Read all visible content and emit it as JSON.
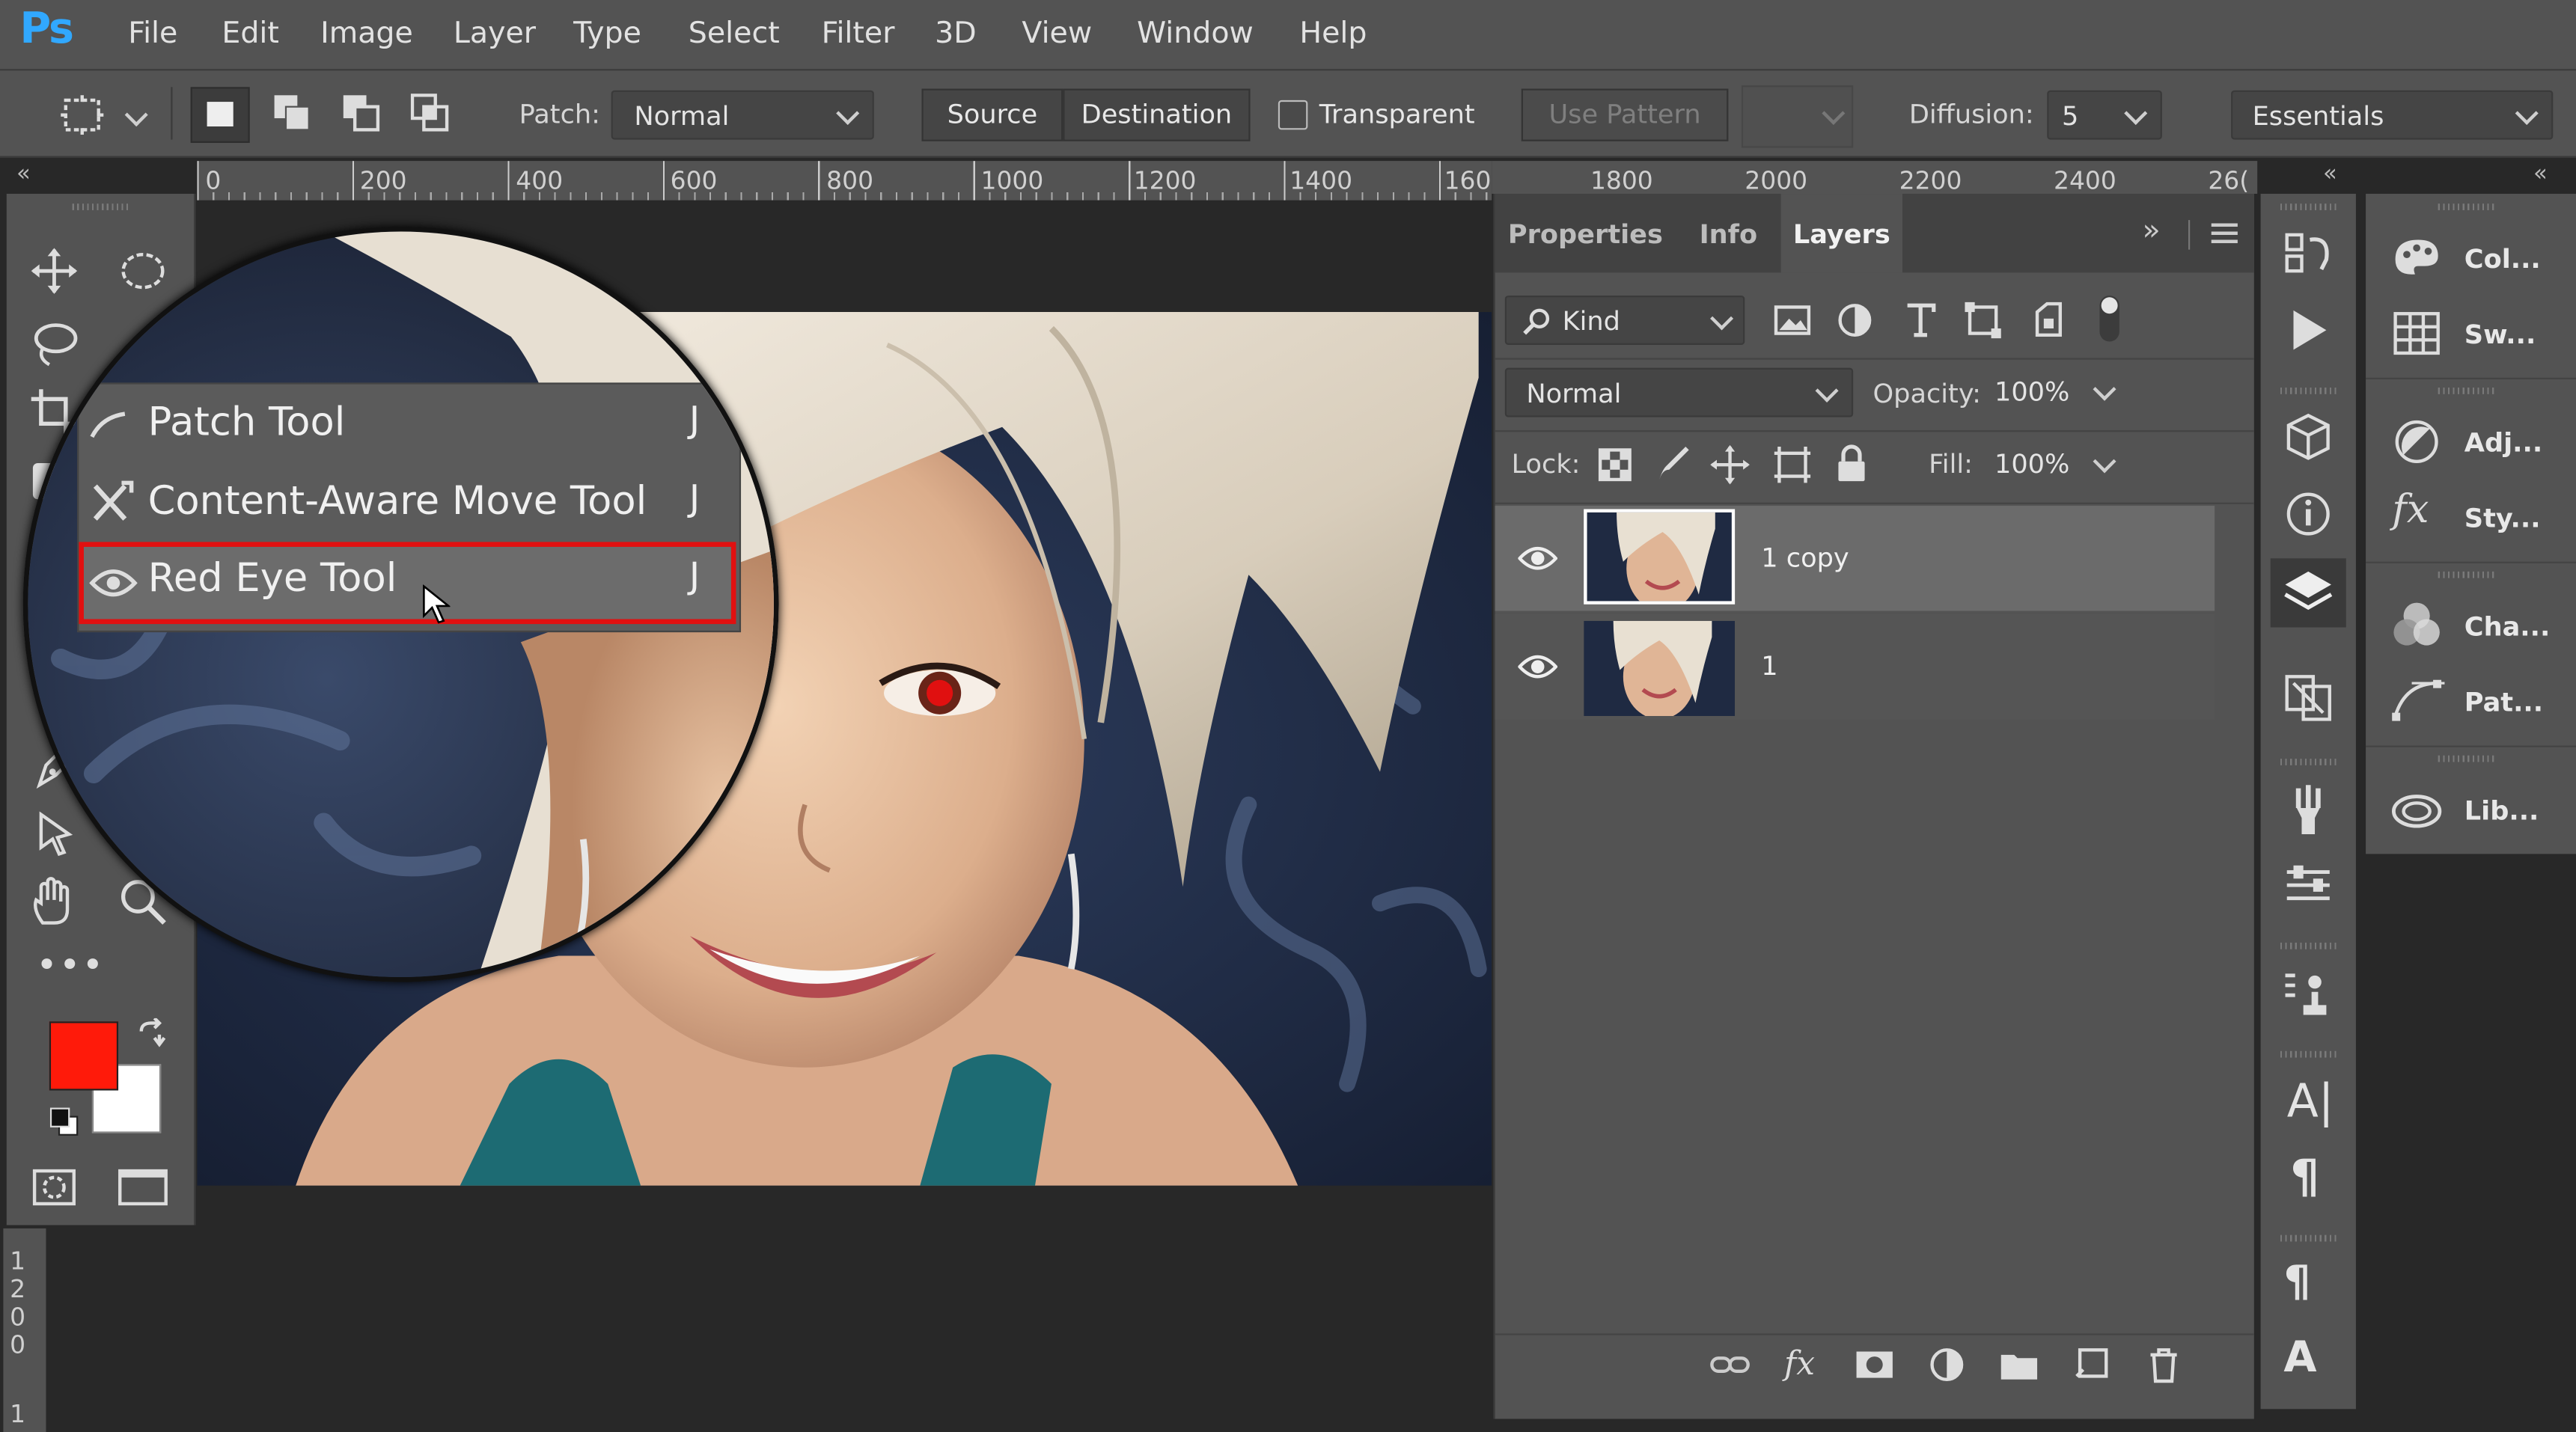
{
  "app": {
    "logo": "Ps"
  },
  "menu": [
    "File",
    "Edit",
    "Image",
    "Layer",
    "Type",
    "Select",
    "Filter",
    "3D",
    "View",
    "Window",
    "Help"
  ],
  "options": {
    "patch_label": "Patch:",
    "patch_mode": "Normal",
    "source_label": "Source",
    "destination_label": "Destination",
    "transparent_label": "Transparent",
    "use_pattern_label": "Use Pattern",
    "diffusion_label": "Diffusion:",
    "diffusion_value": "5",
    "workspace": "Essentials"
  },
  "ruler": {
    "ticks": [
      "0",
      "200",
      "400",
      "600",
      "800",
      "1000",
      "1200",
      "1400",
      "1600",
      "1800",
      "2000",
      "2200",
      "2400",
      "26("
    ]
  },
  "vruler": {
    "digits": [
      "1",
      "2",
      "0",
      "0"
    ],
    "bottom_digit": "1"
  },
  "flyout": {
    "items": [
      {
        "label": "Patch Tool",
        "key": "J",
        "icon": "patch-icon",
        "selected": false
      },
      {
        "label": "Content-Aware Move Tool",
        "key": "J",
        "icon": "content-aware-move-icon",
        "selected": false
      },
      {
        "label": "Red Eye Tool",
        "key": "J",
        "icon": "red-eye-icon",
        "selected": true
      }
    ]
  },
  "colors": {
    "foreground": "#ff1a0a",
    "background": "#ffffff",
    "highlight": "#e01010",
    "ps_blue": "#31a8ff"
  },
  "panel": {
    "tabs": [
      "Properties",
      "Info",
      "Layers"
    ],
    "active_tab": "Layers",
    "filter_kind": "Kind",
    "blend_mode": "Normal",
    "opacity_label": "Opacity:",
    "opacity_value": "100%",
    "lock_label": "Lock:",
    "fill_label": "Fill:",
    "fill_value": "100%",
    "layers": [
      {
        "name": "1 copy",
        "visible": true,
        "selected": true
      },
      {
        "name": "1",
        "visible": true,
        "selected": false
      }
    ]
  },
  "dock": {
    "panels": [
      "Col...",
      "Sw...",
      "Adj...",
      "Sty...",
      "Cha...",
      "Pat...",
      "Lib..."
    ]
  }
}
